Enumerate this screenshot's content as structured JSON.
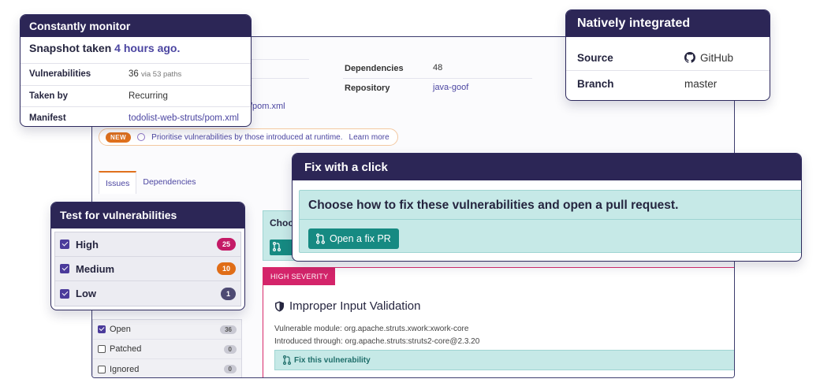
{
  "app": {
    "dependencies_label": "Dependencies",
    "dependencies_value": "48",
    "repository_label": "Repository",
    "repository_value": "java-goof",
    "manifest_fragment": "/pom.xml",
    "tip": {
      "badge": "NEW",
      "text": "Prioritise vulnerabilities by those introduced at runtime.",
      "link": "Learn more"
    },
    "tabs": [
      {
        "label": "Issues"
      },
      {
        "label": "Dependencies"
      }
    ],
    "status_filters": [
      {
        "label": "Open",
        "count": "36",
        "checked": true
      },
      {
        "label": "Patched",
        "count": "0",
        "checked": false
      },
      {
        "label": "Ignored",
        "count": "0",
        "checked": false
      }
    ],
    "choose_fragment": "Choo",
    "vuln": {
      "severity": "HIGH SEVERITY",
      "title": "Improper Input Validation",
      "module_line": "Vulnerable module: org.apache.struts.xwork:xwork-core",
      "introduced_line": "Introduced through: org.apache.struts:struts2-core@2.3.20",
      "fix_label": "Fix this vulnerability"
    }
  },
  "monitor": {
    "title": "Constantly monitor",
    "snapshot_prefix": "Snapshot taken ",
    "snapshot_time": "4 hours ago.",
    "rows": [
      {
        "key": "Vulnerabilities",
        "value": "36",
        "extra": "via 53 paths"
      },
      {
        "key": "Taken by",
        "value": "Recurring",
        "extra": ""
      },
      {
        "key": "Manifest",
        "value": "todolist-web-struts/pom.xml",
        "extra": ""
      }
    ]
  },
  "native": {
    "title": "Natively integrated",
    "rows": [
      {
        "key": "Source",
        "value": "GitHub"
      },
      {
        "key": "Branch",
        "value": "master"
      }
    ]
  },
  "fix": {
    "title": "Fix with a click",
    "prompt": "Choose how to fix these vulnerabilities and open a pull request.",
    "button": "Open a fix PR"
  },
  "test": {
    "title": "Test for vulnerabilities",
    "items": [
      {
        "label": "High",
        "count": "25",
        "color": "#c41a66"
      },
      {
        "label": "Medium",
        "count": "10",
        "color": "#e06d17"
      },
      {
        "label": "Low",
        "count": "1",
        "color": "#4e4a73"
      }
    ]
  },
  "colors": {
    "navy": "#2c2656",
    "purple_link": "#4b45a1",
    "teal": "#168a82",
    "teal_light": "#c6e9e7",
    "severity_pink": "#d4246a"
  }
}
